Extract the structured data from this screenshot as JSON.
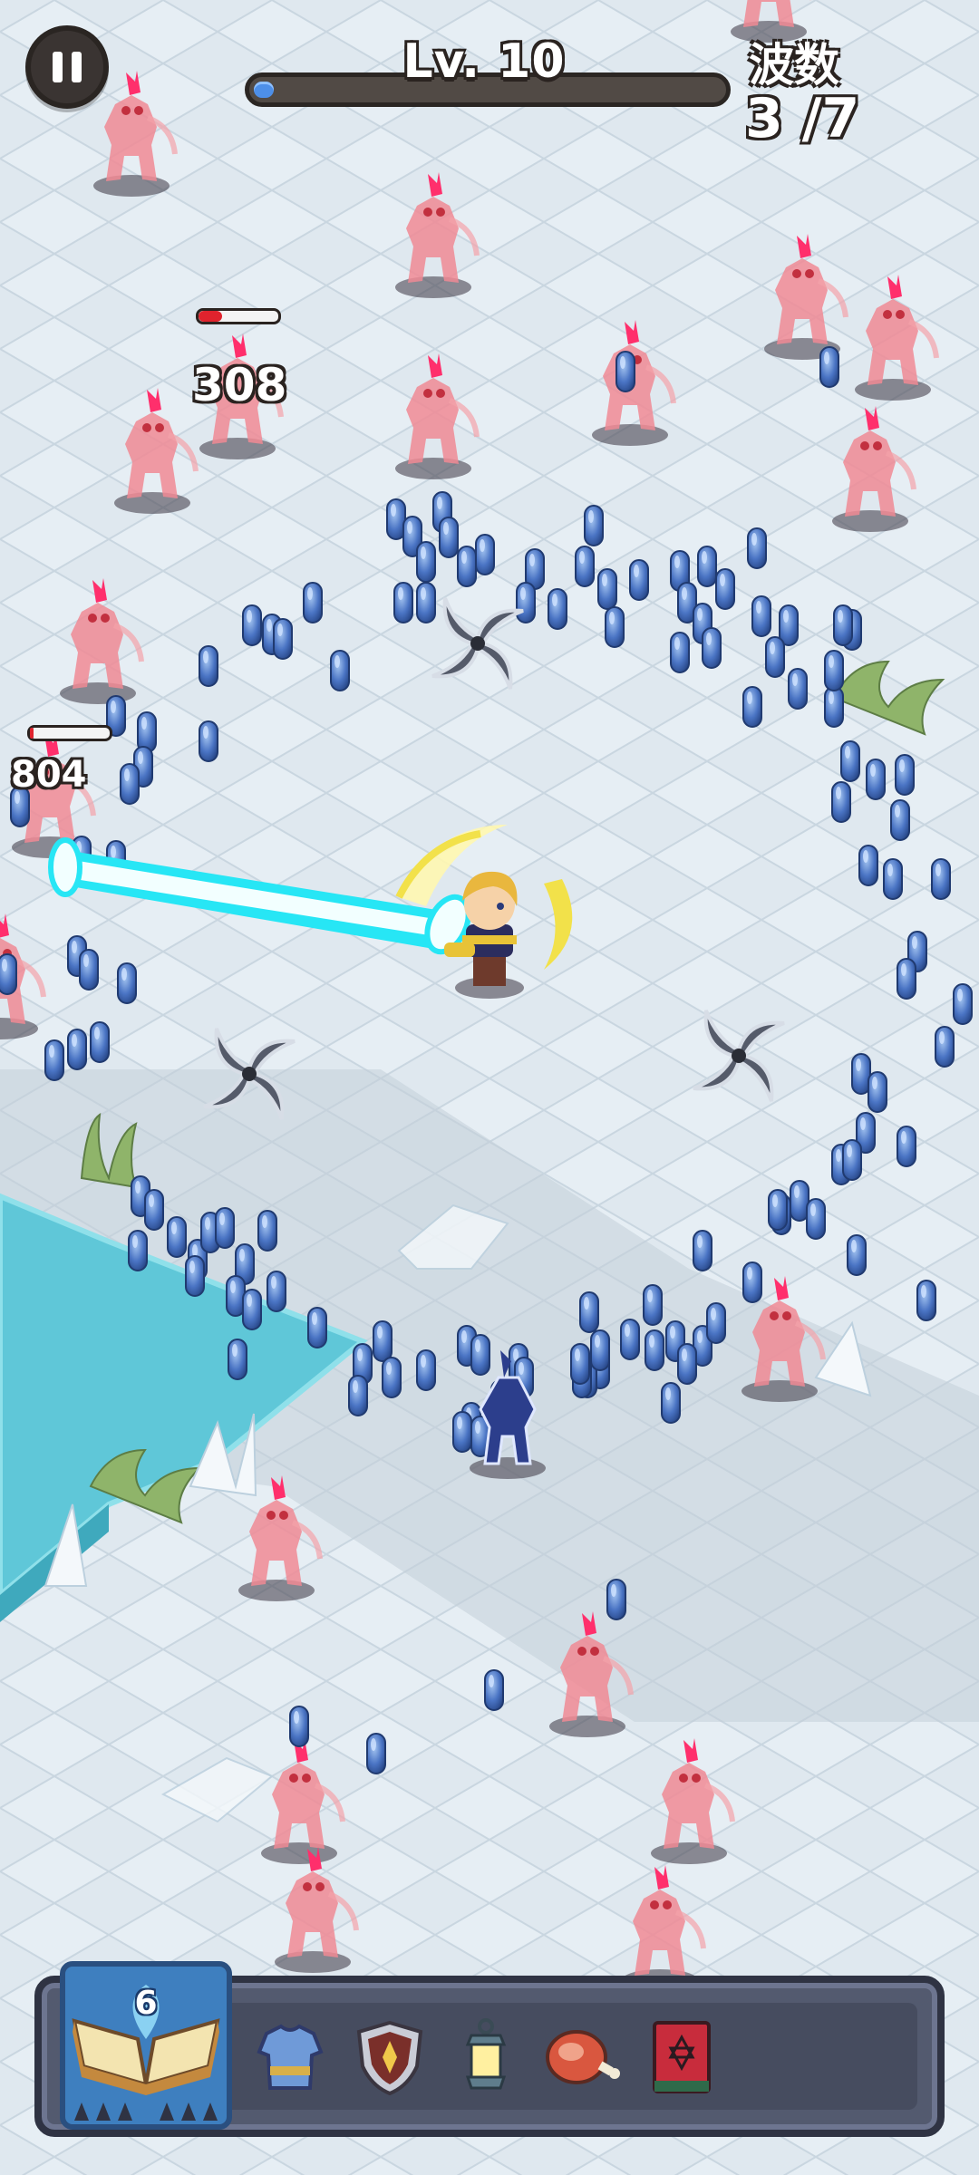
{
  "hud": {
    "level_label": "Lv. 10",
    "xp_progress": 0.035,
    "wave_title": "波数",
    "wave_count": "3 /7",
    "pause_icon": "pause-icon"
  },
  "combat": {
    "damage_numbers": [
      "308",
      "804"
    ],
    "enemy_hp": [
      0.3,
      0.05
    ]
  },
  "skills": {
    "main_skill_level": "6",
    "main_skill_icon": "open-spellbook-icon",
    "slots": [
      {
        "icon": "armor-icon"
      },
      {
        "icon": "shield-icon"
      },
      {
        "icon": "lantern-icon"
      },
      {
        "icon": "meat-icon"
      },
      {
        "icon": "red-tome-icon"
      }
    ]
  },
  "colors": {
    "ice_floor": "#dce6ee",
    "water": "#5fc7d8",
    "xp_fill": "#4d8fe8",
    "laser": "#27e6f5",
    "hp_red": "#e0232d"
  }
}
